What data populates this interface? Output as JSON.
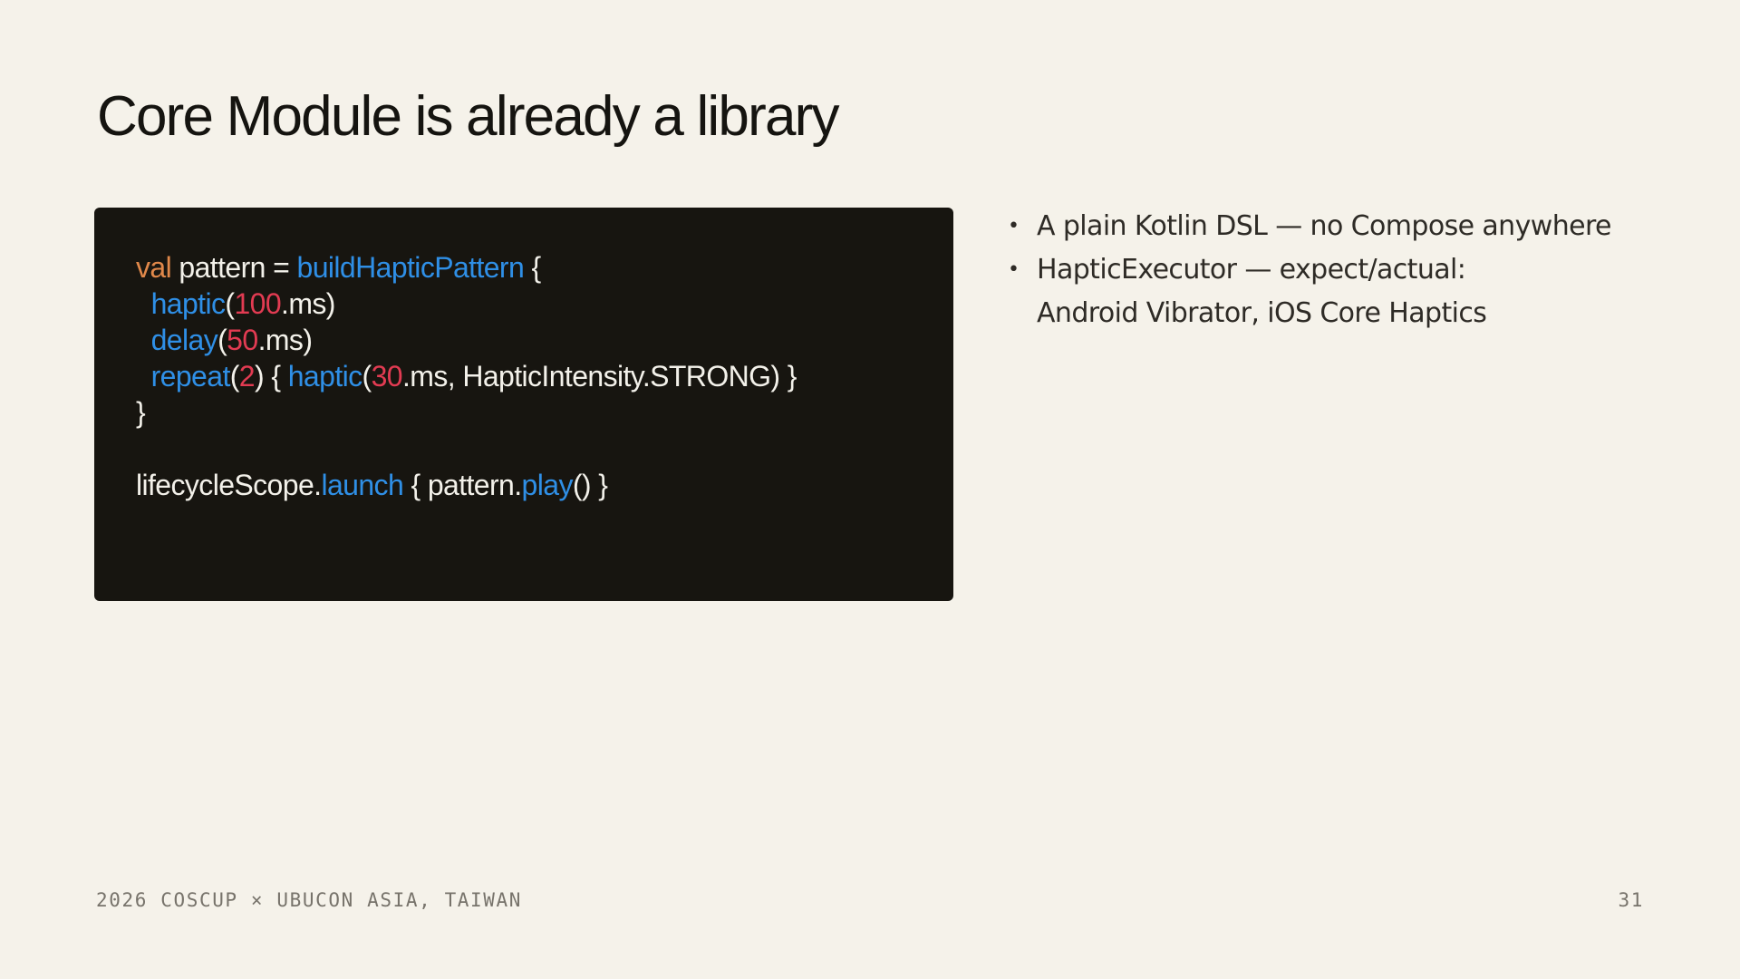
{
  "slide": {
    "title": "Core Module is already a library",
    "page_number": "31",
    "footer": "2026 COSCUP × UBUCON ASIA, TAIWAN"
  },
  "code": {
    "lines": [
      [
        {
          "t": "val",
          "k": "kw"
        },
        {
          "t": " pattern = ",
          "k": "plain"
        },
        {
          "t": "buildHapticPattern",
          "k": "fn"
        },
        {
          "t": " {",
          "k": "plain"
        }
      ],
      [
        {
          "t": "  ",
          "k": "plain"
        },
        {
          "t": "haptic",
          "k": "fn"
        },
        {
          "t": "(",
          "k": "plain"
        },
        {
          "t": "100",
          "k": "num"
        },
        {
          "t": ".ms)",
          "k": "plain"
        }
      ],
      [
        {
          "t": "  ",
          "k": "plain"
        },
        {
          "t": "delay",
          "k": "fn"
        },
        {
          "t": "(",
          "k": "plain"
        },
        {
          "t": "50",
          "k": "num"
        },
        {
          "t": ".ms)",
          "k": "plain"
        }
      ],
      [
        {
          "t": "  ",
          "k": "plain"
        },
        {
          "t": "repeat",
          "k": "fn"
        },
        {
          "t": "(",
          "k": "plain"
        },
        {
          "t": "2",
          "k": "num"
        },
        {
          "t": ") { ",
          "k": "plain"
        },
        {
          "t": "haptic",
          "k": "fn"
        },
        {
          "t": "(",
          "k": "plain"
        },
        {
          "t": "30",
          "k": "num"
        },
        {
          "t": ".ms, HapticIntensity.STRONG) }",
          "k": "plain"
        }
      ],
      [
        {
          "t": "}",
          "k": "plain"
        }
      ],
      [],
      [
        {
          "t": "lifecycleScope.",
          "k": "plain"
        },
        {
          "t": "launch",
          "k": "fn"
        },
        {
          "t": " { pattern.",
          "k": "plain"
        },
        {
          "t": "play",
          "k": "fn"
        },
        {
          "t": "() }",
          "k": "plain"
        }
      ]
    ]
  },
  "bullets": [
    {
      "lines": [
        "A plain Kotlin DSL — no Compose anywhere"
      ]
    },
    {
      "lines": [
        "HapticExecutor — expect/actual:",
        "Android Vibrator, iOS Core Haptics"
      ]
    }
  ],
  "colors": {
    "background": "#f5f2ea",
    "code_background": "#171510",
    "keyword": "#e0884a",
    "function": "#2f8fe6",
    "number": "#e23b52",
    "code_text": "#f3f1ea"
  }
}
